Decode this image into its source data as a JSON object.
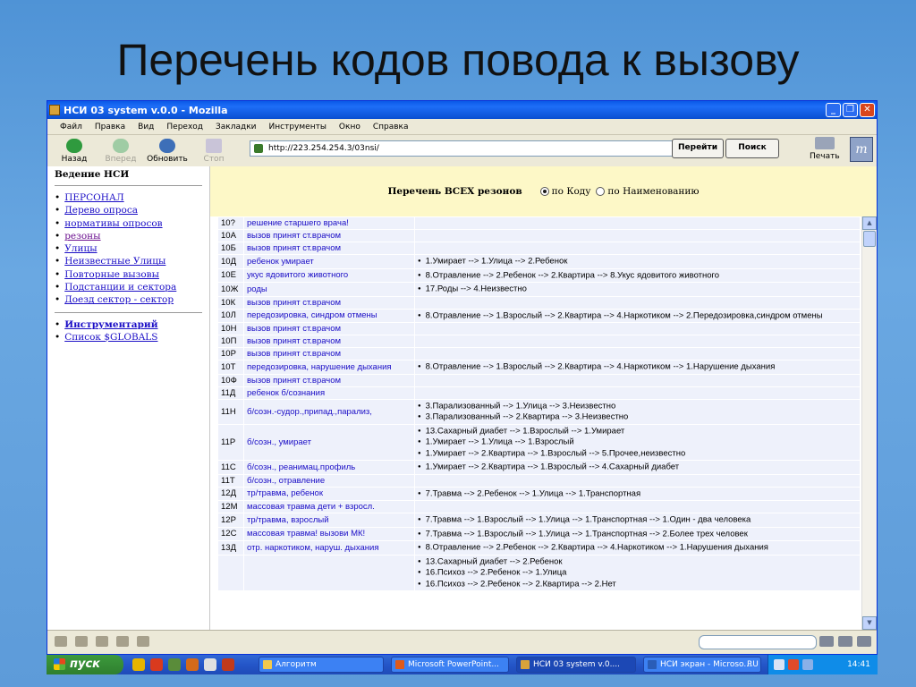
{
  "slide": {
    "title": "Перечень кодов повода к вызову"
  },
  "browser": {
    "title": "НСИ 03 system v.0.0 - Mozilla",
    "menu": [
      "Файл",
      "Правка",
      "Вид",
      "Переход",
      "Закладки",
      "Инструменты",
      "Окно",
      "Справка"
    ],
    "toolbar": {
      "back": "Назад",
      "forward": "Вперед",
      "reload": "Обновить",
      "stop": "Стоп",
      "url": "http://223.254.254.3/03nsi/",
      "go": "Перейти",
      "search": "Поиск",
      "print": "Печать"
    }
  },
  "sidebar": {
    "title": "Ведение НСИ",
    "items": [
      "ПЕРСОНАЛ",
      "Дерево опроса",
      "нормативы опросов",
      "резоны",
      "Улицы",
      "Неизвестные Улицы",
      "Повторные вызовы",
      "Подстанции и сектора",
      "Доезд сектор - сектор"
    ],
    "tools": [
      "Инструментарий",
      "Список $GLOBALS"
    ]
  },
  "main": {
    "heading": "Перечень ВСЕХ резонов",
    "radio_code": "по Коду",
    "radio_name": "по Наименованию"
  },
  "rows": [
    {
      "code": "10?",
      "name": "решение старшего врача!",
      "paths": []
    },
    {
      "code": "10А",
      "name": "вызов принят ст.врачом",
      "paths": []
    },
    {
      "code": "10Б",
      "name": "вызов принят ст.врачом",
      "paths": []
    },
    {
      "code": "10Д",
      "name": "ребенок умирает",
      "paths": [
        "1.Умирает --> 1.Улица --> 2.Ребенок"
      ]
    },
    {
      "code": "10Е",
      "name": "укус ядовитого животного",
      "paths": [
        "8.Отравление --> 2.Ребенок --> 2.Квартира --> 8.Укус ядовитого животного"
      ]
    },
    {
      "code": "10Ж",
      "name": "роды",
      "paths": [
        "17.Роды --> 4.Неизвестно"
      ]
    },
    {
      "code": "10К",
      "name": "вызов принят ст.врачом",
      "paths": []
    },
    {
      "code": "10Л",
      "name": "передозировка, синдром отмены",
      "paths": [
        "8.Отравление --> 1.Взрослый --> 2.Квартира --> 4.Наркотиком --> 2.Передозировка,синдром отмены"
      ]
    },
    {
      "code": "10Н",
      "name": "вызов принят ст.врачом",
      "paths": []
    },
    {
      "code": "10П",
      "name": "вызов принят ст.врачом",
      "paths": []
    },
    {
      "code": "10Р",
      "name": "вызов принят ст.врачом",
      "paths": []
    },
    {
      "code": "10Т",
      "name": "передозировка, нарушение дыхания",
      "paths": [
        "8.Отравление --> 1.Взрослый --> 2.Квартира --> 4.Наркотиком --> 1.Нарушение дыхания"
      ]
    },
    {
      "code": "10Ф",
      "name": "вызов принят ст.врачом",
      "paths": []
    },
    {
      "code": "11Д",
      "name": "ребенок б/сознания",
      "paths": []
    },
    {
      "code": "11Н",
      "name": "б/созн.-судор.,припад.,парализ,",
      "paths": [
        "3.Парализованный --> 1.Улица --> 3.Неизвестно",
        "3.Парализованный --> 2.Квартира --> 3.Неизвестно"
      ]
    },
    {
      "code": "11Р",
      "name": "б/созн., умирает",
      "paths": [
        "13.Сахарный диабет --> 1.Взрослый --> 1.Умирает",
        "1.Умирает --> 1.Улица --> 1.Взрослый",
        "1.Умирает --> 2.Квартира --> 1.Взрослый --> 5.Прочее,неизвестно"
      ]
    },
    {
      "code": "11С",
      "name": "б/созн., реанимац.профиль",
      "paths": [
        "1.Умирает --> 2.Квартира --> 1.Взрослый --> 4.Сахарный диабет"
      ]
    },
    {
      "code": "11Т",
      "name": "б/созн., отравление",
      "paths": []
    },
    {
      "code": "12Д",
      "name": "тр/травма, ребенок",
      "paths": [
        "7.Травма --> 2.Ребенок --> 1.Улица --> 1.Транспортная"
      ]
    },
    {
      "code": "12М",
      "name": "массовая травма дети + взросл.",
      "paths": []
    },
    {
      "code": "12Р",
      "name": "тр/травма, взрослый",
      "paths": [
        "7.Травма --> 1.Взрослый --> 1.Улица --> 1.Транспортная --> 1.Один - два человека"
      ]
    },
    {
      "code": "12С",
      "name": "массовая травма! вызови МК!",
      "paths": [
        "7.Травма --> 1.Взрослый --> 1.Улица --> 1.Транспортная --> 2.Более трех человек"
      ]
    },
    {
      "code": "13Д",
      "name": "отр. наркотиком, наруш. дыхания",
      "paths": [
        "8.Отравление --> 2.Ребенок --> 2.Квартира --> 4.Наркотиком --> 1.Нарушения дыхания"
      ]
    },
    {
      "code": "",
      "name": "",
      "paths": [
        "13.Сахарный диабет --> 2.Ребенок",
        "16.Психоз --> 2.Ребенок --> 1.Улица",
        "16.Психоз --> 2.Ребенок --> 2.Квартира --> 2.Нет"
      ]
    }
  ],
  "taskbar": {
    "start": "пуск",
    "tasks": [
      "Алгоритм",
      "Microsoft PowerPoint...",
      "НСИ 03 system v.0....",
      "НСИ экран - Microso..."
    ],
    "lang": "RU",
    "clock": "14:41"
  }
}
